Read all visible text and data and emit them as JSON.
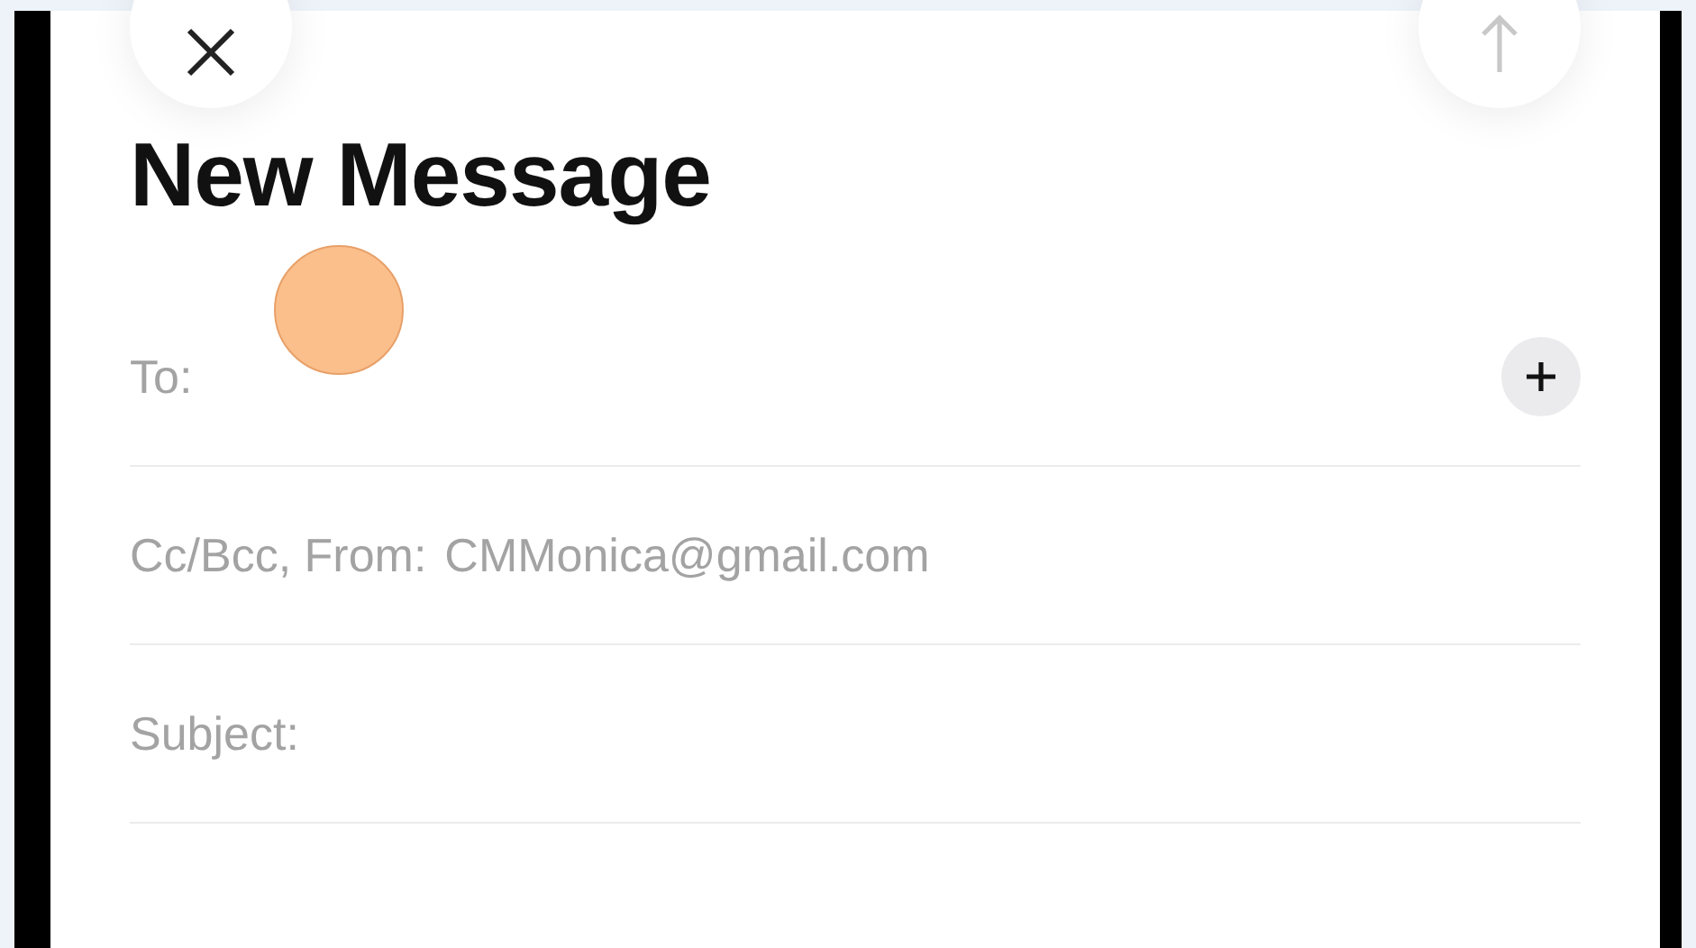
{
  "title": "New Message",
  "send_enabled": false,
  "fields": [
    {
      "kind": "recipients",
      "label": "To:"
    },
    {
      "kind": "sender",
      "label": "Cc/Bcc, From:",
      "value": "CMMonica@gmail.com"
    },
    {
      "kind": "subject",
      "label": "Subject:"
    }
  ]
}
